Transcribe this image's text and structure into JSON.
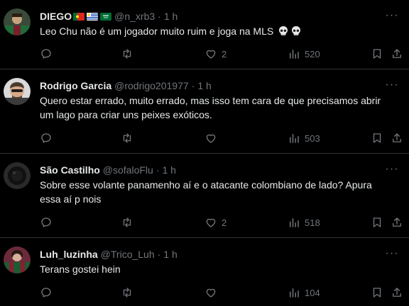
{
  "tweets": [
    {
      "name": "DIEGO",
      "flags": [
        "flag-portugal",
        "flag-uruguay",
        "flag-saudi-arabia"
      ],
      "handle": "@n_xrb3",
      "time": "1 h",
      "text": "Leo Chu não é um jogador muito ruim e joga na MLS",
      "emoji": [
        "skull-emoji",
        "skull-emoji"
      ],
      "replies": "",
      "retweets": "",
      "likes": "2",
      "views": "520"
    },
    {
      "name": "Rodrigo Garcia",
      "handle": "@rodrigo201977",
      "time": "1 h",
      "text": "Quero estar errado, muito errado, mas isso tem cara de que precisamos abrir um lago para criar uns peixes exóticos.",
      "replies": "",
      "retweets": "",
      "likes": "",
      "views": "503"
    },
    {
      "name": "São Castilho",
      "handle": "@sofaloFlu",
      "time": "1 h",
      "text": "Sobre esse volante panamenho aí e o atacante colombiano de lado? Apura essa aí p nois",
      "replies": "",
      "retweets": "",
      "likes": "2",
      "views": "518"
    },
    {
      "name": "Luh_luzinha",
      "handle": "@Trico_Luh",
      "time": "1 h",
      "text": "Terans gostei hein",
      "replies": "",
      "retweets": "",
      "likes": "",
      "views": "104"
    }
  ],
  "dot": "·",
  "more": "···",
  "colors": {
    "background": "#000000",
    "text": "#e7e9ea",
    "muted": "#71767b",
    "border": "#2f3336"
  }
}
